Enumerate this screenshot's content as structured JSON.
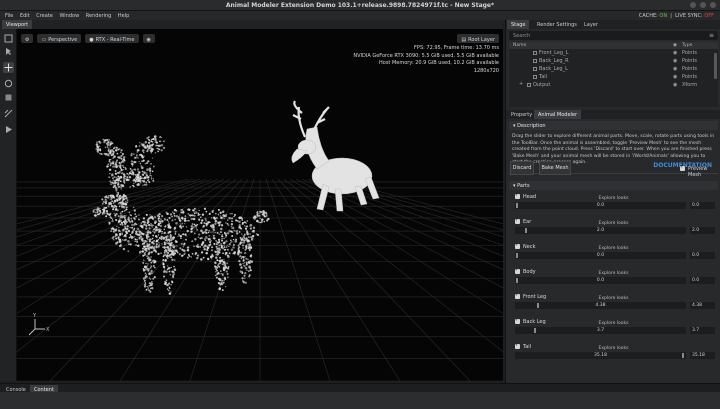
{
  "window": {
    "title": "Animal Modeler Extension Demo 103.1+release.9898.7824971f.tc - New Stage*"
  },
  "menu": {
    "items": [
      "File",
      "Edit",
      "Create",
      "Window",
      "Rendering",
      "Help"
    ],
    "cache_label": "CACHE:",
    "cache_value": "ON",
    "livesync_label": "LIVE SYNC:",
    "livesync_value": "OFF"
  },
  "viewport": {
    "tab": "Viewport",
    "perspective": "Perspective",
    "renderer": "RTX - Real-Time",
    "root_layer": "Root Layer",
    "stats": [
      "FPS: 72.95, Frame time: 13.70 ms",
      "NVIDIA GeForce RTX 3090: 5.5 GiB used, 5.5 GiB available",
      "Host Memory: 20.9 GiB used, 10.2 GiB available",
      "1280x720"
    ]
  },
  "bottom_tabs": [
    "Console",
    "Content"
  ],
  "right": {
    "tabs": [
      "Stage",
      "Render Settings",
      "Layer"
    ],
    "search_placeholder": "Search",
    "stage_headers": {
      "name": "Name",
      "type": "Type"
    },
    "stage_rows": [
      {
        "name": "Front_Leg_L",
        "type": "Points"
      },
      {
        "name": "Back_Leg_R",
        "type": "Points"
      },
      {
        "name": "Back_Leg_L",
        "type": "Points"
      },
      {
        "name": "Tail",
        "type": "Points"
      },
      {
        "name": "Output",
        "type": "Xform"
      }
    ],
    "prop_tabs": [
      "Property",
      "Animal Modeler"
    ],
    "description_title": "Description",
    "description": "Drag the slider to explore different animal parts. Move, scale, rotate parts using tools in the ToolBar. Once the animal is assembled, toggle 'Preview Mesh' to see the mesh created from the point cloud. Press 'Discard' to start over. When you are finished press 'Bake Mesh' and your animal mesh will be stored in '/World/Animals' allowing you to start the creation process again.",
    "documentation": "DOCUMENTATION",
    "discard": "Discard",
    "bake_mesh": "Bake Mesh",
    "preview_mesh": "Preview Mesh",
    "parts_title": "Parts",
    "parts": [
      {
        "name": "Head",
        "explore": "Explore looks",
        "value": "0.0",
        "box": "0.0",
        "level": 0.0
      },
      {
        "name": "Ear",
        "explore": "Explore looks",
        "value": "2.0",
        "box": "2.0",
        "level": 0.057
      },
      {
        "name": "Neck",
        "explore": "Explore looks",
        "value": "0.0",
        "box": "0.0",
        "level": 0.0
      },
      {
        "name": "Body",
        "explore": "Explore looks",
        "value": "0.0",
        "box": "0.0",
        "level": 0.0
      },
      {
        "name": "Front Leg",
        "explore": "Explore looks",
        "value": "4.38",
        "box": "4.38",
        "level": 0.125
      },
      {
        "name": "Back Leg",
        "explore": "Explore looks",
        "value": "3.7",
        "box": "3.7",
        "level": 0.106
      },
      {
        "name": "Tail",
        "explore": "Explore looks",
        "value": "35.18",
        "box": "35.18",
        "level": 1.0
      }
    ]
  },
  "colors": {
    "accent_link": "#3e8de0",
    "on": "#7ac04a",
    "off": "#d04a4a"
  }
}
